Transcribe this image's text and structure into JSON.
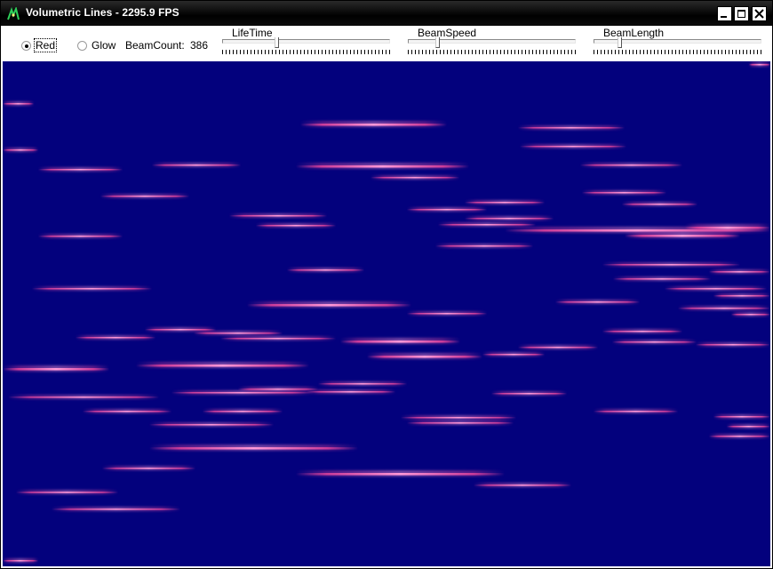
{
  "window": {
    "title": "Volumetric Lines - 2295.9 FPS"
  },
  "controls": {
    "mode_options": [
      {
        "label": "Red",
        "selected": true
      },
      {
        "label": "Glow",
        "selected": false
      }
    ],
    "beam_count_label": "BeamCount:",
    "beam_count_value": "386",
    "sliders": [
      {
        "label": "LifeTime",
        "value_fraction": 0.32
      },
      {
        "label": "BeamSpeed",
        "value_fraction": 0.17
      },
      {
        "label": "BeamLength",
        "value_fraction": 0.15
      }
    ]
  },
  "colors": {
    "background": "#03017d",
    "beam_core": "#ff9ad8",
    "beam_glow": "#e8459e"
  },
  "icons": {
    "app": "volumetric-lines-app-icon",
    "minimize": "minimize-icon",
    "maximize": "maximize-icon",
    "close": "close-icon"
  }
}
